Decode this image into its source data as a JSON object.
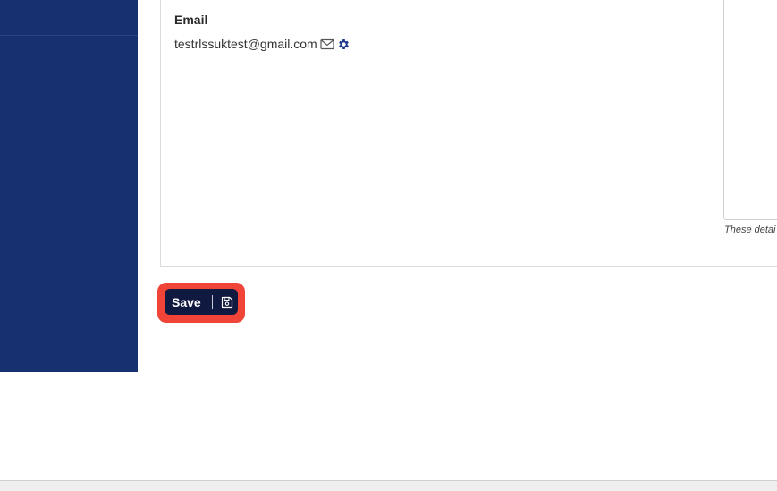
{
  "email_section": {
    "label": "Email",
    "value": "testrlssuktest@gmail.com",
    "icons": [
      "envelope-icon",
      "gear-icon"
    ]
  },
  "side_note": {
    "text": "These detai"
  },
  "save_button": {
    "label": "Save",
    "icon": "floppy-disk-icon"
  },
  "colors": {
    "sidebar": "#17306f",
    "button_bg": "#10193f",
    "highlight": "#ef4437",
    "gear": "#1d3a8a"
  }
}
